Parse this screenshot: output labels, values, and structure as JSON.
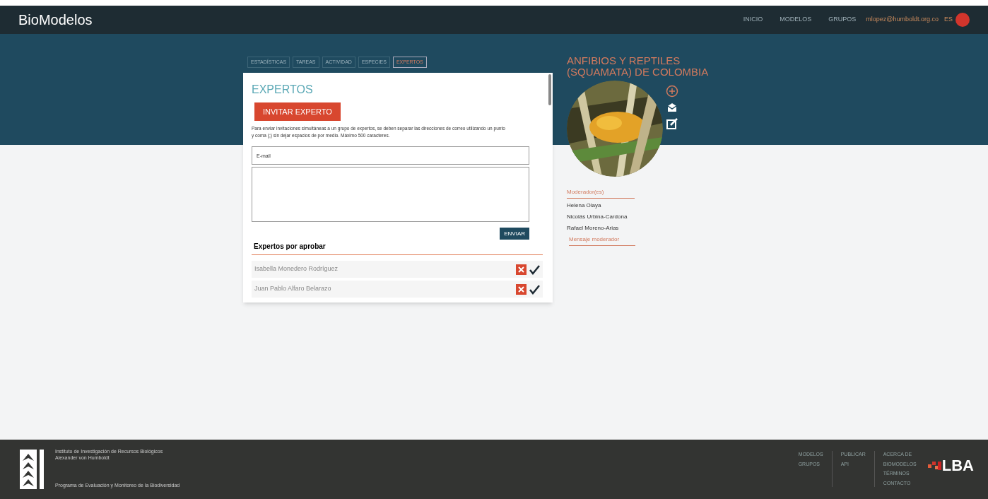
{
  "header": {
    "brand": "BioModelos",
    "nav": [
      {
        "label": "INICIO"
      },
      {
        "label": "MODELOS"
      },
      {
        "label": "GRUPOS"
      }
    ],
    "user_email": "mlopez@humboldt.org.co",
    "language": "ES"
  },
  "tabs": [
    {
      "label": "ESTADÍSTICAS",
      "selected": false
    },
    {
      "label": "TAREAS",
      "selected": false
    },
    {
      "label": "ACTIVIDAD",
      "selected": false
    },
    {
      "label": "ESPECIES",
      "selected": false
    },
    {
      "label": "EXPERTOS",
      "selected": true
    }
  ],
  "panel": {
    "title": "EXPERTOS",
    "invite_button": "INVITAR EXPERTO",
    "instructions": "Para enviar invitaciones simultáneas a un grupo de expertos, se deben separar las direcciones de correo utilizando un punto y coma (;) sin dejar espacios de por medio. Máximo 500 caracteres.",
    "email_placeholder": "E-mail",
    "send_button": "ENVIAR",
    "pending_title": "Expertos por aprobar",
    "pending": [
      {
        "name": "Isabella Monedero Rodríguez"
      },
      {
        "name": "Juan Pablo Alfaro Belarazo"
      }
    ]
  },
  "group": {
    "title": "ANFIBIOS Y REPTILES (SQUAMATA) DE COLOMBIA",
    "moderators_label": "Moderador(es)",
    "moderators": [
      "Helena Olaya",
      "Nicolás Urbina-Cardona",
      "Rafael Moreno-Arias"
    ],
    "message_link": "Mensaje moderador"
  },
  "footer": {
    "institute": [
      "Instituto de Investigación de Recursos Biológicos",
      "Alexander von Humboldt"
    ],
    "program": "Programa de Evaluación y Monitoreo de la Biodiversidad",
    "link_columns": [
      [
        "MODELOS",
        "GRUPOS"
      ],
      [
        "PUBLICAR",
        "API"
      ],
      [
        "ACERCA DE",
        "BIOMODELOS",
        "TÉRMINOS",
        "CONTACTO"
      ]
    ],
    "partner_logo": "LBA"
  }
}
